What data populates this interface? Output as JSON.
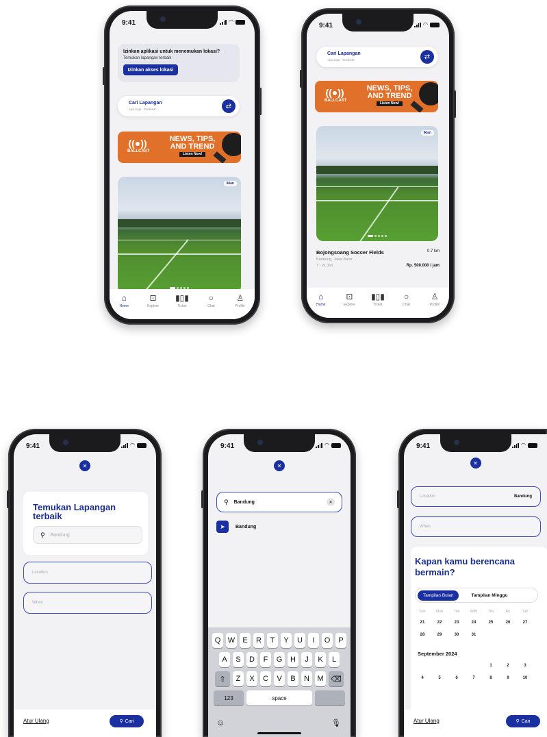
{
  "status": {
    "time": "9:41"
  },
  "screen1": {
    "permission_title": "Izinkan aplikasi untuk menemukan lokasi?",
    "permission_sub": "Temukan lapangan terbaik",
    "permission_button": "Izinkan akses lokasi",
    "search_title": "Cari Lapangan",
    "search_sub": "Apa Saja · Terdekat"
  },
  "banner": {
    "brand": "BALLCAST",
    "headline_1": "NEWS, TIPS,",
    "headline_2": "AND TREND",
    "cta": "Listen Now!"
  },
  "photo_tag": "Iklan",
  "screen2": {
    "search_title": "Cari Lapangan",
    "search_sub": "Apa Saja · Terdekat",
    "venue_name": "Bojongsoang Soccer Fields",
    "venue_distance": "0.7 km",
    "venue_location": "Bandung, Jawa Barat",
    "venue_dates": "7 - 21 Juli",
    "venue_price": "Rp. 500.000 / jam"
  },
  "tabs": [
    {
      "label": "Home",
      "icon": "home-icon"
    },
    {
      "label": "Explore",
      "icon": "explore-icon"
    },
    {
      "label": "Ticket",
      "icon": "barcode-icon"
    },
    {
      "label": "Chat",
      "icon": "chat-icon"
    },
    {
      "label": "Profile",
      "icon": "profile-icon"
    }
  ],
  "screen3": {
    "title": "Temukan Lapangan terbaik",
    "search_placeholder": "Bandung",
    "location_placeholder": "Location",
    "when_placeholder": "When",
    "reset": "Atur Ulang",
    "search_button": "Cari"
  },
  "screen4": {
    "search_value": "Bandung",
    "result": "Bandung",
    "keys_row1": [
      "Q",
      "W",
      "E",
      "R",
      "T",
      "Y",
      "U",
      "I",
      "O",
      "P"
    ],
    "keys_row2": [
      "A",
      "S",
      "D",
      "F",
      "G",
      "H",
      "J",
      "K",
      "L"
    ],
    "keys_row3": [
      "Z",
      "X",
      "C",
      "V",
      "B",
      "N",
      "M"
    ],
    "key_123": "123",
    "key_space": "space"
  },
  "screen5": {
    "location_label": "Location",
    "location_value": "Bandung",
    "when_label": "When",
    "question": "Kapan kamu berencana bermain?",
    "tab_month": "Tampilan Bulan",
    "tab_week": "Tampilan Minggu",
    "weekdays": [
      "Sun",
      "Mon",
      "Tue",
      "Wed",
      "Thu",
      "Fri",
      "Sat"
    ],
    "week1": [
      "21",
      "22",
      "23",
      "24",
      "25",
      "26",
      "27"
    ],
    "week2": [
      "28",
      "29",
      "30",
      "31",
      "",
      "",
      ""
    ],
    "month2": "September 2024",
    "week3": [
      "",
      "",
      "",
      "",
      "1",
      "2",
      "3"
    ],
    "week4": [
      "4",
      "5",
      "6",
      "7",
      "8",
      "9",
      "10"
    ],
    "reset": "Atur Ulang",
    "search_button": "Cari"
  },
  "colors": {
    "primary": "#1a2fa0",
    "banner": "#e0702a",
    "screen_bg": "#f2f2f4"
  }
}
